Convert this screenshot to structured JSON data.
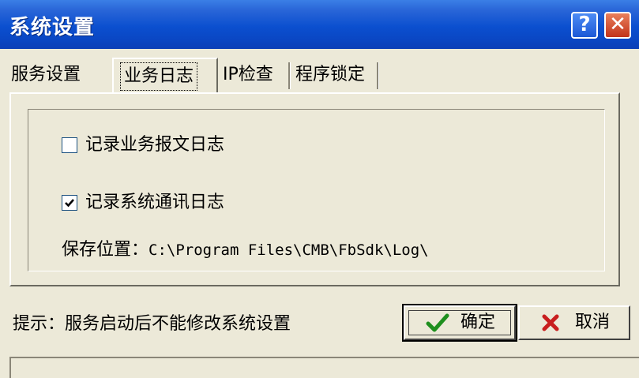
{
  "window": {
    "title": "系统设置",
    "help_label": "?",
    "close_label": "✕"
  },
  "tabs": [
    {
      "label": "服务设置"
    },
    {
      "label": "业务日志",
      "active": true
    },
    {
      "label": "IP检查"
    },
    {
      "label": "程序锁定"
    }
  ],
  "log_settings": {
    "business_log": {
      "label": "记录业务报文日志",
      "checked": false
    },
    "system_log": {
      "label": "记录系统通讯日志",
      "checked": true
    },
    "save_location_label": "保存位置：",
    "save_location_value": "C:\\Program Files\\CMB\\FbSdk\\Log\\"
  },
  "footer": {
    "hint": "提示：服务启动后不能修改系统设置",
    "ok_label": "确定",
    "cancel_label": "取消"
  },
  "colors": {
    "titlebar": "#0b4fcf",
    "window_bg": "#ece9d8",
    "ok_check": "#1e8f1e",
    "cancel_x": "#c81e1e"
  }
}
